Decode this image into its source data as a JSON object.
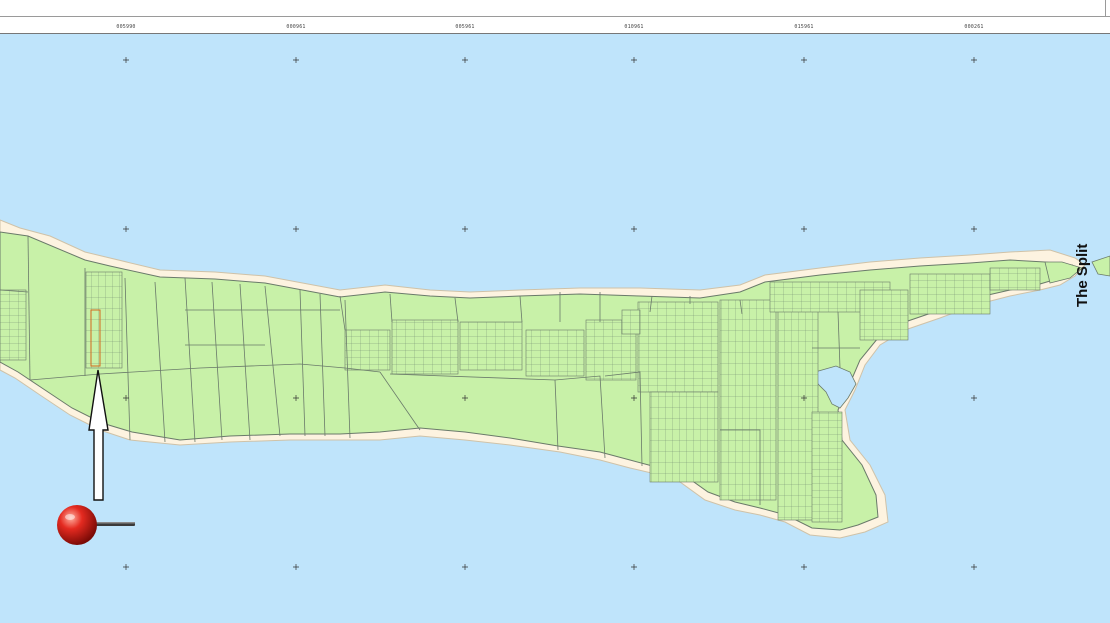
{
  "map": {
    "ruler_labels": [
      "005990",
      "000961",
      "005961",
      "010961",
      "015961",
      "000261"
    ],
    "place_label": "The Split",
    "marker": "red-pushpin-icon",
    "pointer": "up-arrow-icon",
    "colors": {
      "water": "#bfe4fb",
      "land": "#c8f1a8",
      "beach": "#fdf3e0",
      "parcel_line": "#6a7a6a",
      "highlight_parcel": "#d2691e",
      "pin": "#e0201c"
    }
  }
}
